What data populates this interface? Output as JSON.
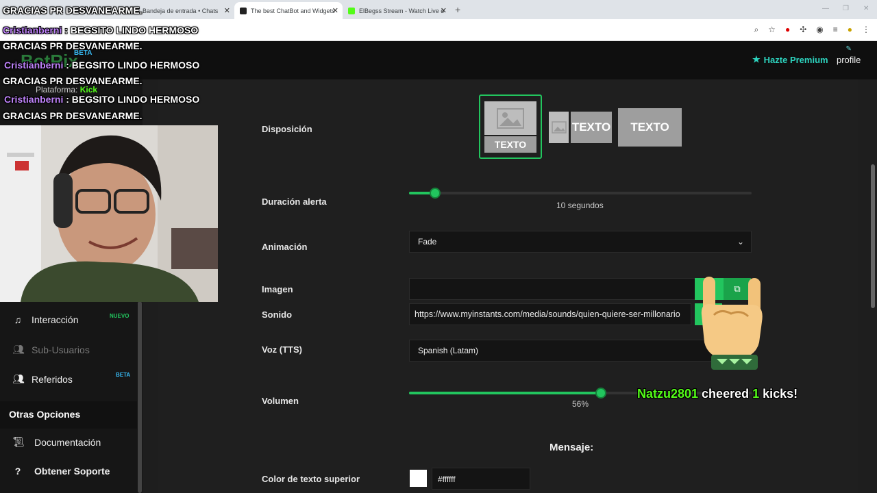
{
  "browser": {
    "tabs": [
      {
        "label": "Bandeja de entrada • Chats",
        "active": false
      },
      {
        "label": "The best ChatBot and Widgets",
        "active": true
      },
      {
        "label": "ElBegss Stream - Watch Live o",
        "active": false
      }
    ]
  },
  "header": {
    "logo": "BotRix",
    "logo_badge": "BETA",
    "premium_label": "Hazte Premium",
    "profile_label": "profile",
    "platform_label": "Plataforma:",
    "platform_value": "Kick"
  },
  "sidebar": {
    "items": [
      {
        "label": "Interacción",
        "badge": "NUEVO",
        "icon": "music-note-icon",
        "disabled": false
      },
      {
        "label": "Sub-Usuarios",
        "badge": "",
        "icon": "users-icon",
        "disabled": true
      },
      {
        "label": "Referidos",
        "badge": "BETA",
        "icon": "user-group-icon",
        "disabled": false
      }
    ],
    "section_title": "Otras Opciones",
    "extra_items": [
      {
        "label": "Documentación",
        "icon": "scroll-icon"
      },
      {
        "label": "Obtener Soporte",
        "icon": "help-icon"
      }
    ]
  },
  "form": {
    "disposicion_label": "Disposición",
    "layout_text": "TEXTO",
    "duracion_label": "Duración alerta",
    "duracion_value": "10 segundos",
    "duracion_fraction": 0.075,
    "animacion_label": "Animación",
    "animacion_value": "Fade",
    "imagen_label": "Imagen",
    "imagen_value": "",
    "sonido_label": "Sonido",
    "sonido_value": "https://www.myinstants.com/media/sounds/quien-quiere-ser-millonario",
    "voz_label": "Voz (TTS)",
    "voz_value": "Spanish (Latam)",
    "volumen_label": "Volumen",
    "volumen_value": "56%",
    "volumen_fraction": 0.56,
    "mensaje_title": "Mensaje:",
    "color_label": "Color de texto superior",
    "color_value": "#ffffff"
  },
  "overlay": {
    "chat": [
      {
        "user": "",
        "text": "GRACIAS PR DESVANEARME."
      },
      {
        "user": "Cristianberni",
        "text": " : BEGSITO LINDO HERMOSO"
      },
      {
        "user": "",
        "text": "GRACIAS PR DESVANEARME."
      },
      {
        "user": "Cristianberni",
        "text": " : BEGSITO LINDO HERMOSO"
      },
      {
        "user": "",
        "text": "GRACIAS PR DESVANEARME."
      },
      {
        "user": "Cristianberni",
        "text": " : BEGSITO LINDO HERMOSO"
      },
      {
        "user": "",
        "text": "GRACIAS PR DESVANEARME."
      }
    ],
    "cheer_user": "Natzu2801",
    "cheer_text": " cheered ",
    "cheer_amount": "1",
    "cheer_suffix": " kicks!"
  },
  "colors": {
    "accent": "#22c55e",
    "premium": "#2dd4bf",
    "kick": "#53fc18"
  }
}
